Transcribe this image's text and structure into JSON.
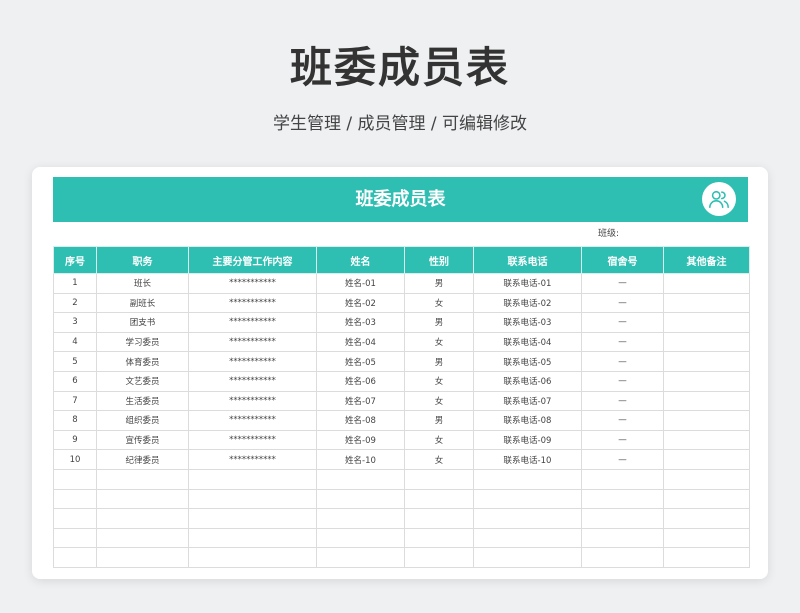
{
  "page": {
    "title": "班委成员表",
    "subtitle": "学生管理 /  成员管理  /  可编辑修改"
  },
  "sheet": {
    "title": "班委成员表",
    "class_label": "班级:",
    "accent_color": "#2ebfb2",
    "icon": "users-icon",
    "columns": [
      "序号",
      "职务",
      "主要分管工作内容",
      "姓名",
      "性别",
      "联系电话",
      "宿舍号",
      "其他备注"
    ],
    "rows": [
      [
        "1",
        "班长",
        "***********",
        "姓名-01",
        "男",
        "联系电话-01",
        "—",
        ""
      ],
      [
        "2",
        "副班长",
        "***********",
        "姓名-02",
        "女",
        "联系电话-02",
        "—",
        ""
      ],
      [
        "3",
        "团支书",
        "***********",
        "姓名-03",
        "男",
        "联系电话-03",
        "—",
        ""
      ],
      [
        "4",
        "学习委员",
        "***********",
        "姓名-04",
        "女",
        "联系电话-04",
        "—",
        ""
      ],
      [
        "5",
        "体育委员",
        "***********",
        "姓名-05",
        "男",
        "联系电话-05",
        "—",
        ""
      ],
      [
        "6",
        "文艺委员",
        "***********",
        "姓名-06",
        "女",
        "联系电话-06",
        "—",
        ""
      ],
      [
        "7",
        "生活委员",
        "***********",
        "姓名-07",
        "女",
        "联系电话-07",
        "—",
        ""
      ],
      [
        "8",
        "组织委员",
        "***********",
        "姓名-08",
        "男",
        "联系电话-08",
        "—",
        ""
      ],
      [
        "9",
        "宣传委员",
        "***********",
        "姓名-09",
        "女",
        "联系电话-09",
        "—",
        ""
      ],
      [
        "10",
        "纪律委员",
        "***********",
        "姓名-10",
        "女",
        "联系电话-10",
        "—",
        ""
      ],
      [
        "",
        "",
        "",
        "",
        "",
        "",
        "",
        ""
      ],
      [
        "",
        "",
        "",
        "",
        "",
        "",
        "",
        ""
      ],
      [
        "",
        "",
        "",
        "",
        "",
        "",
        "",
        ""
      ],
      [
        "",
        "",
        "",
        "",
        "",
        "",
        "",
        ""
      ],
      [
        "",
        "",
        "",
        "",
        "",
        "",
        "",
        ""
      ]
    ]
  }
}
